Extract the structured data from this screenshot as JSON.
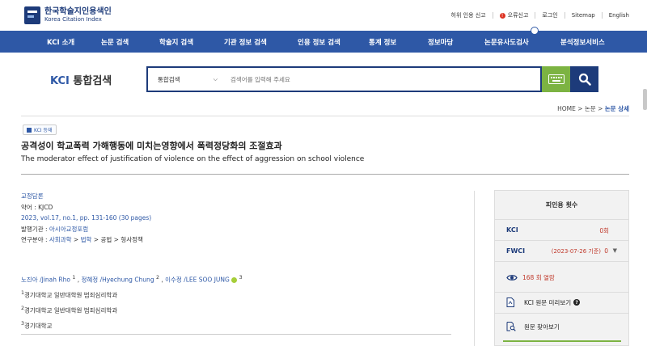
{
  "brand": {
    "name_ko": "한국학술지인용색인",
    "name_en": "Korea Citation Index"
  },
  "util": {
    "report": "허위 인용 신고",
    "error_report": "오류신고",
    "login": "로그인",
    "sitemap": "Sitemap",
    "english": "English"
  },
  "nav": {
    "items": [
      "KCI 소개",
      "논문 검색",
      "학술지 검색",
      "기관 정보 검색",
      "인용 정보 검색",
      "통계 정보",
      "정보마당",
      "논문유사도검사",
      "분석정보서비스"
    ]
  },
  "search": {
    "logo_prefix": "KCI",
    "logo_suffix": "통합검색",
    "select_value": "통합검색",
    "placeholder": "검색어를 입력해 주세요"
  },
  "breadcrumb": {
    "home": "HOME",
    "sep1": " > ",
    "section": "논문",
    "sep2": " > ",
    "current": "논문 상세"
  },
  "article": {
    "badge": "KCI 등재",
    "title_ko": "공격성이 학교폭력 가해행동에 미치는영향에서 폭력정당화의 조절효과",
    "title_en": "The moderator effect of justification of violence on the effect of aggression on school violence"
  },
  "meta": {
    "journal": "교정담론",
    "abbr": "약어 : KJCD",
    "volume": "2023, vol.17, no.1, pp. 131-160 (30 pages)",
    "publisher_label": "발행기관 : ",
    "publisher": "아시아교정포럼",
    "field_label": "연구분야 : ",
    "field_1": "사회과학",
    "field_sep1": " > ",
    "field_2": "법학",
    "field_rest": " > 공법 > 형사정책"
  },
  "authors": {
    "a1": "노진아 /Jinah Rho",
    "a1_sup": "1",
    "a2": "정혜정 /Hyechung Chung",
    "a2_sup": "2",
    "a3": "이수정 /LEE SOO JUNG",
    "a3_sup": "3",
    "sep": " , ",
    "aff1_num": "1",
    "aff1": "경기대학교 일반대학원 범죄심리학과",
    "aff2_num": "2",
    "aff2": "경기대학교 일반대학원 범죄심리학과",
    "aff3_num": "3",
    "aff3": "경기대학교"
  },
  "citations": {
    "title": "피인용 횟수",
    "kci_label": "KCI",
    "kci_value": "0회",
    "fwci_label": "FWCI",
    "fwci_date": "(2023-07-26 기준)",
    "fwci_value": "0",
    "views": "168 회 열람",
    "preview": "KCI 원문 미리보기",
    "find_original": "원문 찾아보기"
  },
  "colors": {
    "nav_bg": "#2e58a6",
    "brand_dark": "#1d3b7a",
    "accent_green": "#7cb342",
    "count_red": "#c0392b"
  }
}
